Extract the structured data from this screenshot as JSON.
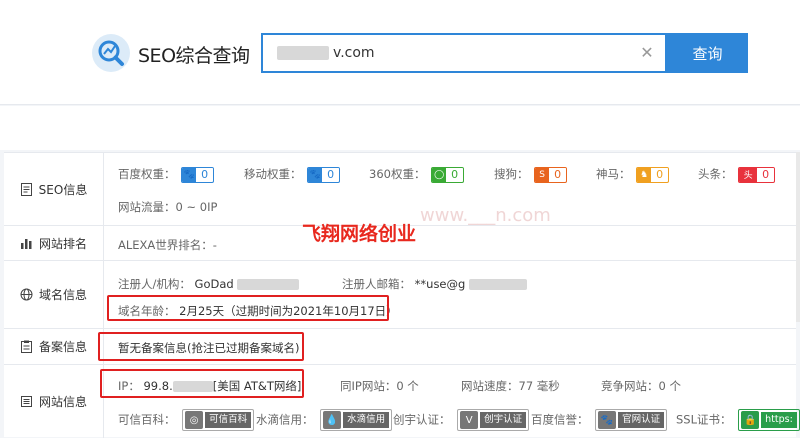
{
  "header": {
    "logo_text": "SEO综合查询",
    "search_value": "v.com",
    "search_button": "查询",
    "clear_icon": "close-icon"
  },
  "rows": {
    "seo": {
      "label": "SEO信息",
      "baidu_label": "百度权重：",
      "baidu_value": "0",
      "mobile_label": "移动权重：",
      "mobile_value": "0",
      "r360_label": "360权重：",
      "r360_value": "0",
      "sogou_label": "搜狗：",
      "sogou_value": "0",
      "shenma_label": "神马：",
      "shenma_value": "0",
      "toutiao_label": "头条：",
      "toutiao_value": "0",
      "traffic": "网站流量：0 ~ 0IP"
    },
    "rank": {
      "label": "网站排名",
      "alexa": "ALEXA世界排名：-"
    },
    "domain": {
      "label": "域名信息",
      "registrar_label": "注册人/机构：",
      "registrar_value": "GoDad",
      "email_label": "注册人邮箱：",
      "email_value": "**use@g",
      "age_label": "域名年龄：",
      "age_value": "2月25天（过期时间为2021年10月17日）"
    },
    "beian": {
      "label": "备案信息",
      "value": "暂无备案信息(抢注已过期备案域名)"
    },
    "site": {
      "label": "网站信息",
      "ip_label": "IP：",
      "ip_prefix": "99.8.",
      "ip_suffix": "[美国 AT&T网络]",
      "same_ip": "同IP网站：0 个",
      "speed": "网站速度：77 毫秒",
      "competitor": "竞争网站：0 个",
      "kexin_label": "可信百科：",
      "kexin_badge": "可信百科",
      "shuidi_label": "水滴信用：",
      "shuidi_badge": "水滴信用",
      "chuangyu_label": "创宇认证：",
      "chuangyu_badge": "创宇认证",
      "baidu_xinyu_label": "百度信誉：",
      "baidu_xinyu_badge": "官网认证",
      "ssl_label": "SSL证书：",
      "ssl_badge": "https:"
    }
  },
  "watermark": "飞翔网络创业",
  "colors": {
    "accent": "#2e86d8",
    "highlight": "#e02020"
  }
}
